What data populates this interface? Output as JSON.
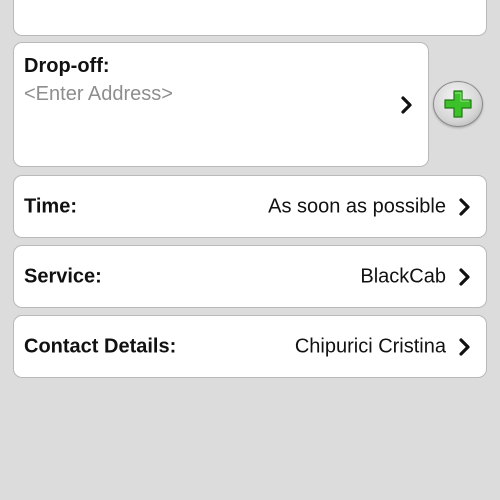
{
  "dropoff": {
    "label": "Drop-off:",
    "placeholder": "<Enter Address>"
  },
  "rows": [
    {
      "label": "Time:",
      "value": "As soon as possible"
    },
    {
      "label": "Service:",
      "value": "BlackCab"
    },
    {
      "label": "Contact Details:",
      "value": "Chipurici Cristina"
    }
  ],
  "icons": {
    "chevron": "chevron-right-icon",
    "add": "plus-icon"
  },
  "colors": {
    "background": "#dcdcdc",
    "card": "#ffffff",
    "placeholder": "#8e8e8e",
    "plus_green": "#3cc12a"
  }
}
